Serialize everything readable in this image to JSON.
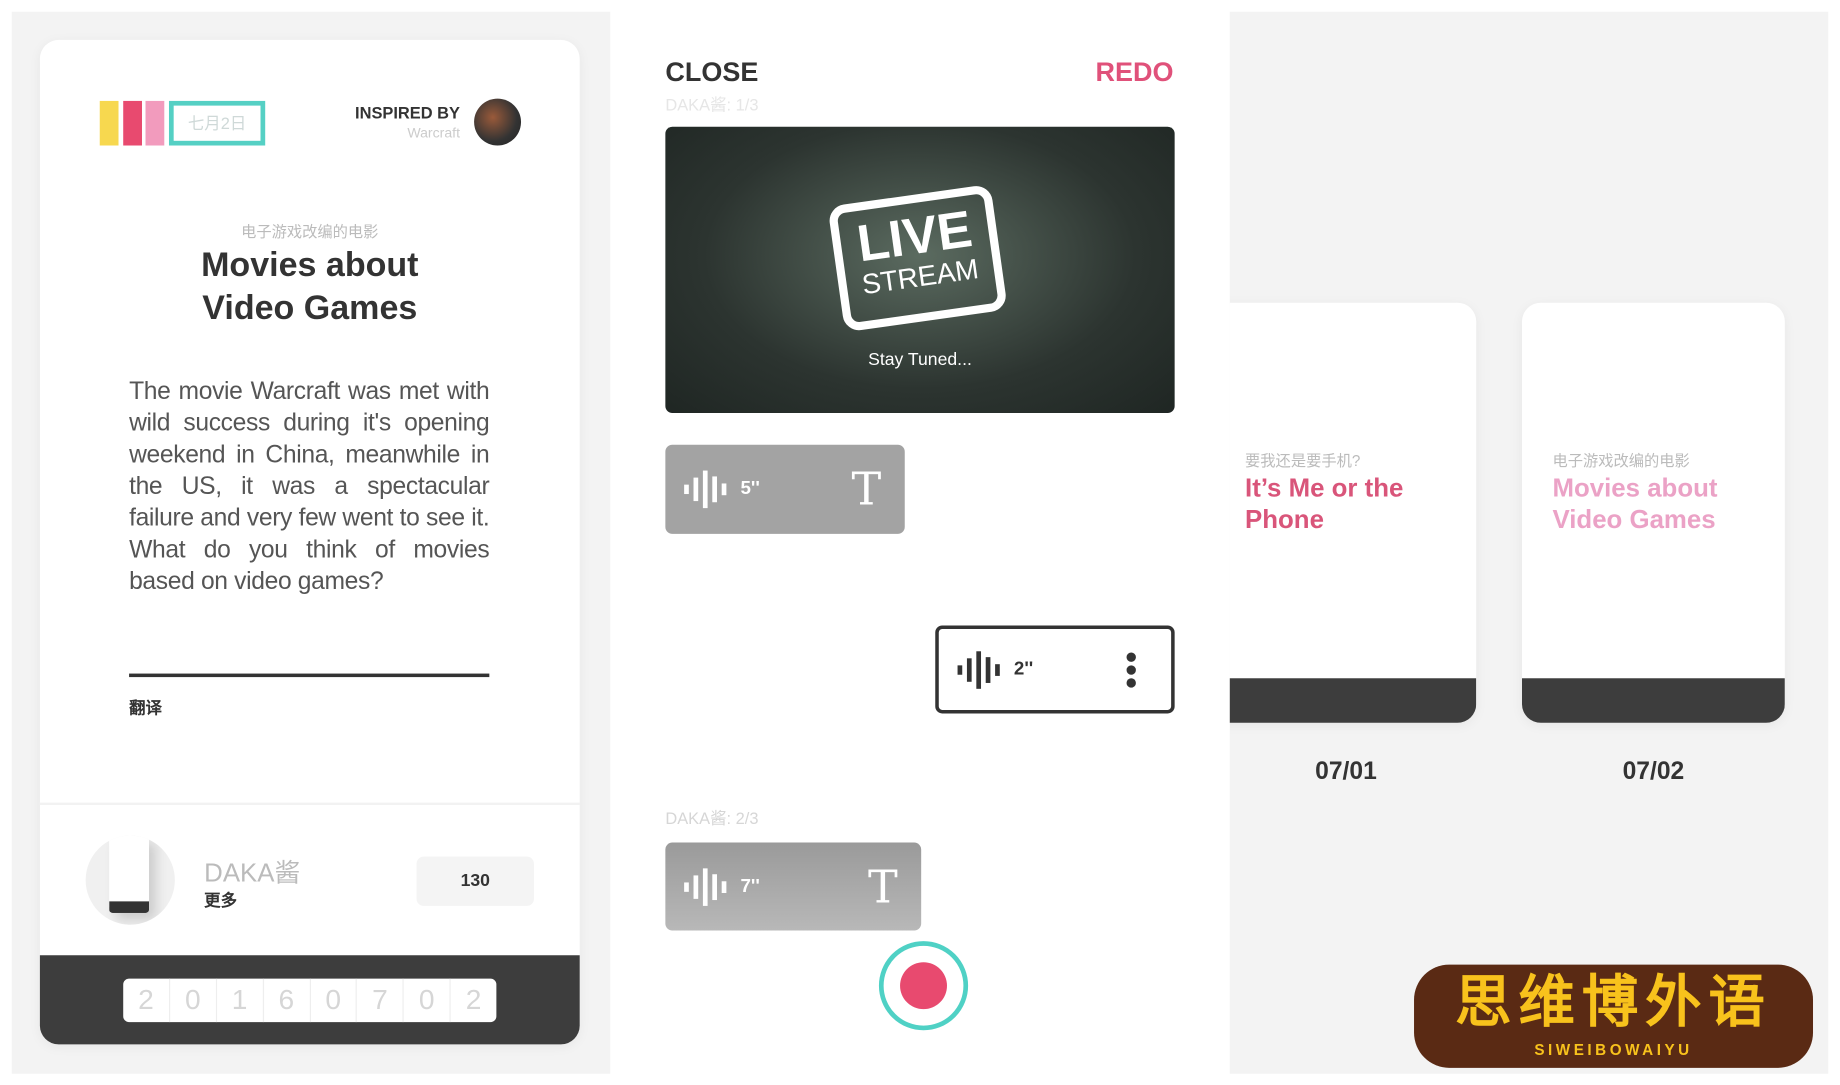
{
  "left_card": {
    "color_bars": [
      "#f7d84f",
      "#e84a6f",
      "#f29bbd"
    ],
    "date_badge": "七月2日",
    "inspired_label": "INSPIRED BY",
    "inspired_source": "Warcraft",
    "subtitle_cn": "电子游戏改编的电影",
    "title": "Movies about Video Games",
    "body": "The movie Warcraft was met with wild success during it's opening weekend in China, meanwhile in the US, it was a spectacular failure and very few went to see it. What do you think of movies based on video games?",
    "translate_link": "翻译",
    "user_name": "DAKA酱",
    "more_link": "更多",
    "count_button": "130",
    "date_digits": [
      "2",
      "0",
      "1",
      "6",
      "0",
      "7",
      "0",
      "2"
    ]
  },
  "recorder": {
    "close_label": "CLOSE",
    "redo_label": "REDO",
    "section1_label": "DAKA酱: 1/3",
    "video_title_line1": "LIVE",
    "video_title_line2": "STREAM",
    "video_caption": "Stay Tuned...",
    "clip1_duration": "5''",
    "clip2_duration": "2''",
    "section2_label": "DAKA酱: 2/3",
    "clip3_duration": "7''",
    "accent": "#e0517a",
    "record_ring": "#4fd1c5"
  },
  "history": {
    "cards": [
      {
        "subtitle_cn": "要我还是要手机?",
        "title": "It’s Me or the Phone",
        "color": "#d9557a",
        "date": "07/01"
      },
      {
        "subtitle_cn": "电子游戏改编的电影",
        "title": "Movies about Video Games",
        "color": "#eba2c6",
        "date": "07/02"
      }
    ]
  },
  "watermark": {
    "text": "思维博外语",
    "latin": "SIWEIBOWAIYU"
  }
}
